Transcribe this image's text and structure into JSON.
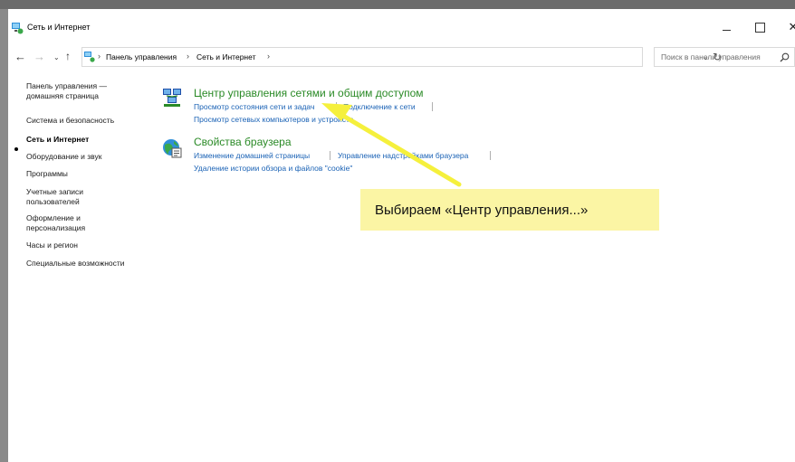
{
  "window": {
    "title": "Сеть и Интернет",
    "minimize_label": "",
    "close_glyph": "✕"
  },
  "navigation": {
    "back_glyph": "←",
    "forward_glyph": "→",
    "recent_glyph": "⌄",
    "up_glyph": "↑",
    "breadcrumbs": [
      "Панель управления",
      "Сеть и Интернет"
    ],
    "crumb_separator": "›",
    "dropdown_glyph": "⌄",
    "refresh_glyph": "↻"
  },
  "search": {
    "placeholder": "Поиск в панели управления"
  },
  "sidebar": {
    "items": [
      {
        "label_line1": "Панель управления —",
        "label_line2": "домашняя страница"
      },
      {
        "label_line1": "Система и безопасность"
      },
      {
        "label_line1": "Сеть и Интернет",
        "active": true
      },
      {
        "label_line1": "Оборудование и звук"
      },
      {
        "label_line1": "Программы"
      },
      {
        "label_line1": "Учетные записи",
        "label_line2": "пользователей"
      },
      {
        "label_line1": "Оформление и",
        "label_line2": "персонализация"
      },
      {
        "label_line1": "Часы и регион"
      },
      {
        "label_line1": "Специальные возможности"
      }
    ]
  },
  "categories": [
    {
      "title": "Центр управления сетями и общим доступом",
      "links": [
        "Просмотр состояния сети и задач",
        "Подключение к сети",
        "Просмотр сетевых компьютеров и устройств"
      ],
      "icon": "network-center-icon"
    },
    {
      "title": "Свойства браузера",
      "links": [
        "Изменение домашней страницы",
        "Управление надстройками браузера",
        "Удаление истории обзора и файлов \"cookie\""
      ],
      "icon": "browser-properties-icon"
    }
  ],
  "annotation": {
    "text": "Выбираем «Центр управления...»",
    "background": "#fbf5a4",
    "arrow_color": "#f5f03c"
  },
  "colors": {
    "link": "#1a62b5",
    "category_title": "#2a8a26"
  }
}
